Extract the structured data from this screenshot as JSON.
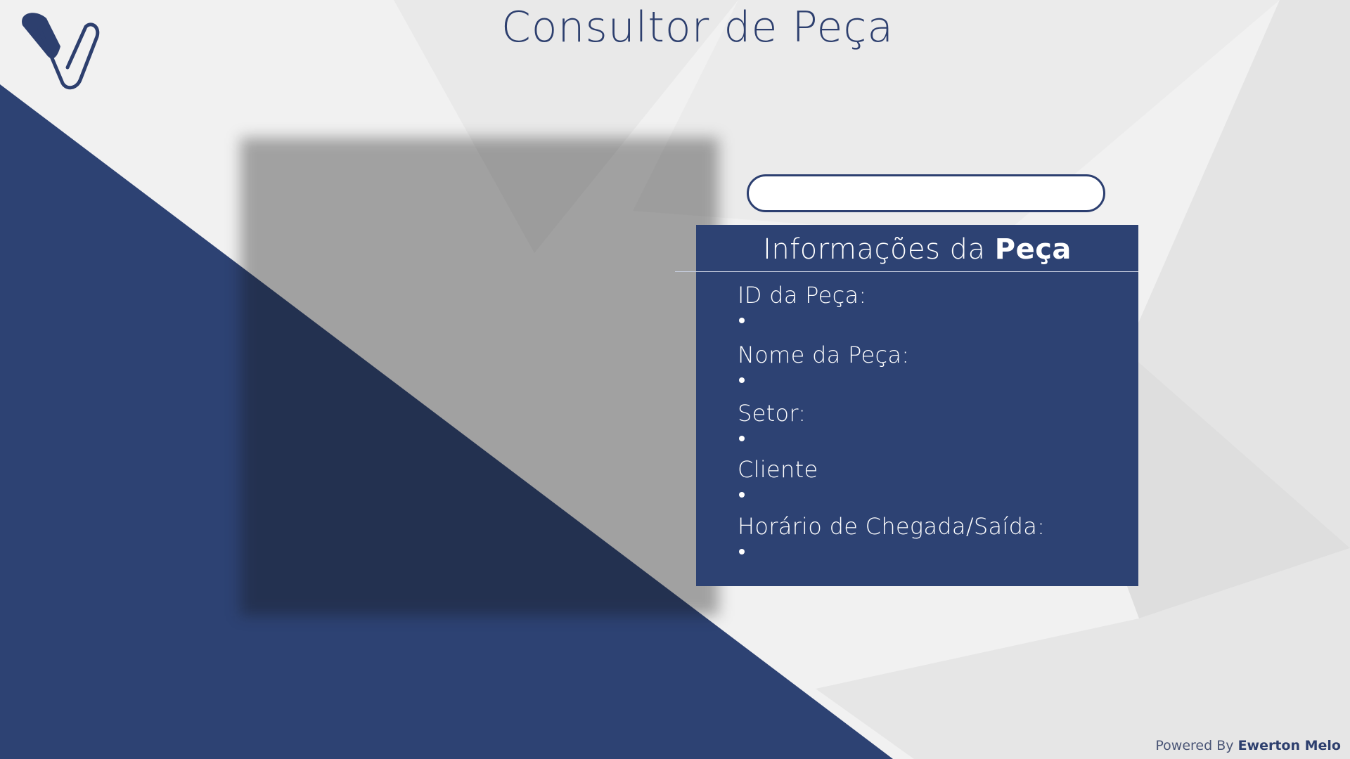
{
  "app": {
    "title": "Consultor de Peça",
    "logo_icon": "v-check-logo-icon"
  },
  "search": {
    "value": "",
    "placeholder": ""
  },
  "info_panel": {
    "title_regular": "Informações da",
    "title_bold": "Peça",
    "fields": [
      {
        "label": "ID da Peça:",
        "value": ""
      },
      {
        "label": "Nome da Peça:",
        "value": ""
      },
      {
        "label": "Setor:",
        "value": ""
      },
      {
        "label": "Cliente",
        "value": ""
      },
      {
        "label": "Horário de Chegada/Saída:",
        "value": ""
      }
    ]
  },
  "footer": {
    "powered_prefix": "Powered By",
    "author": "Ewerton Melo"
  },
  "colors": {
    "brand_navy": "#2d4273",
    "title_navy": "#2d3f6e",
    "background": "#f1f1f1"
  }
}
